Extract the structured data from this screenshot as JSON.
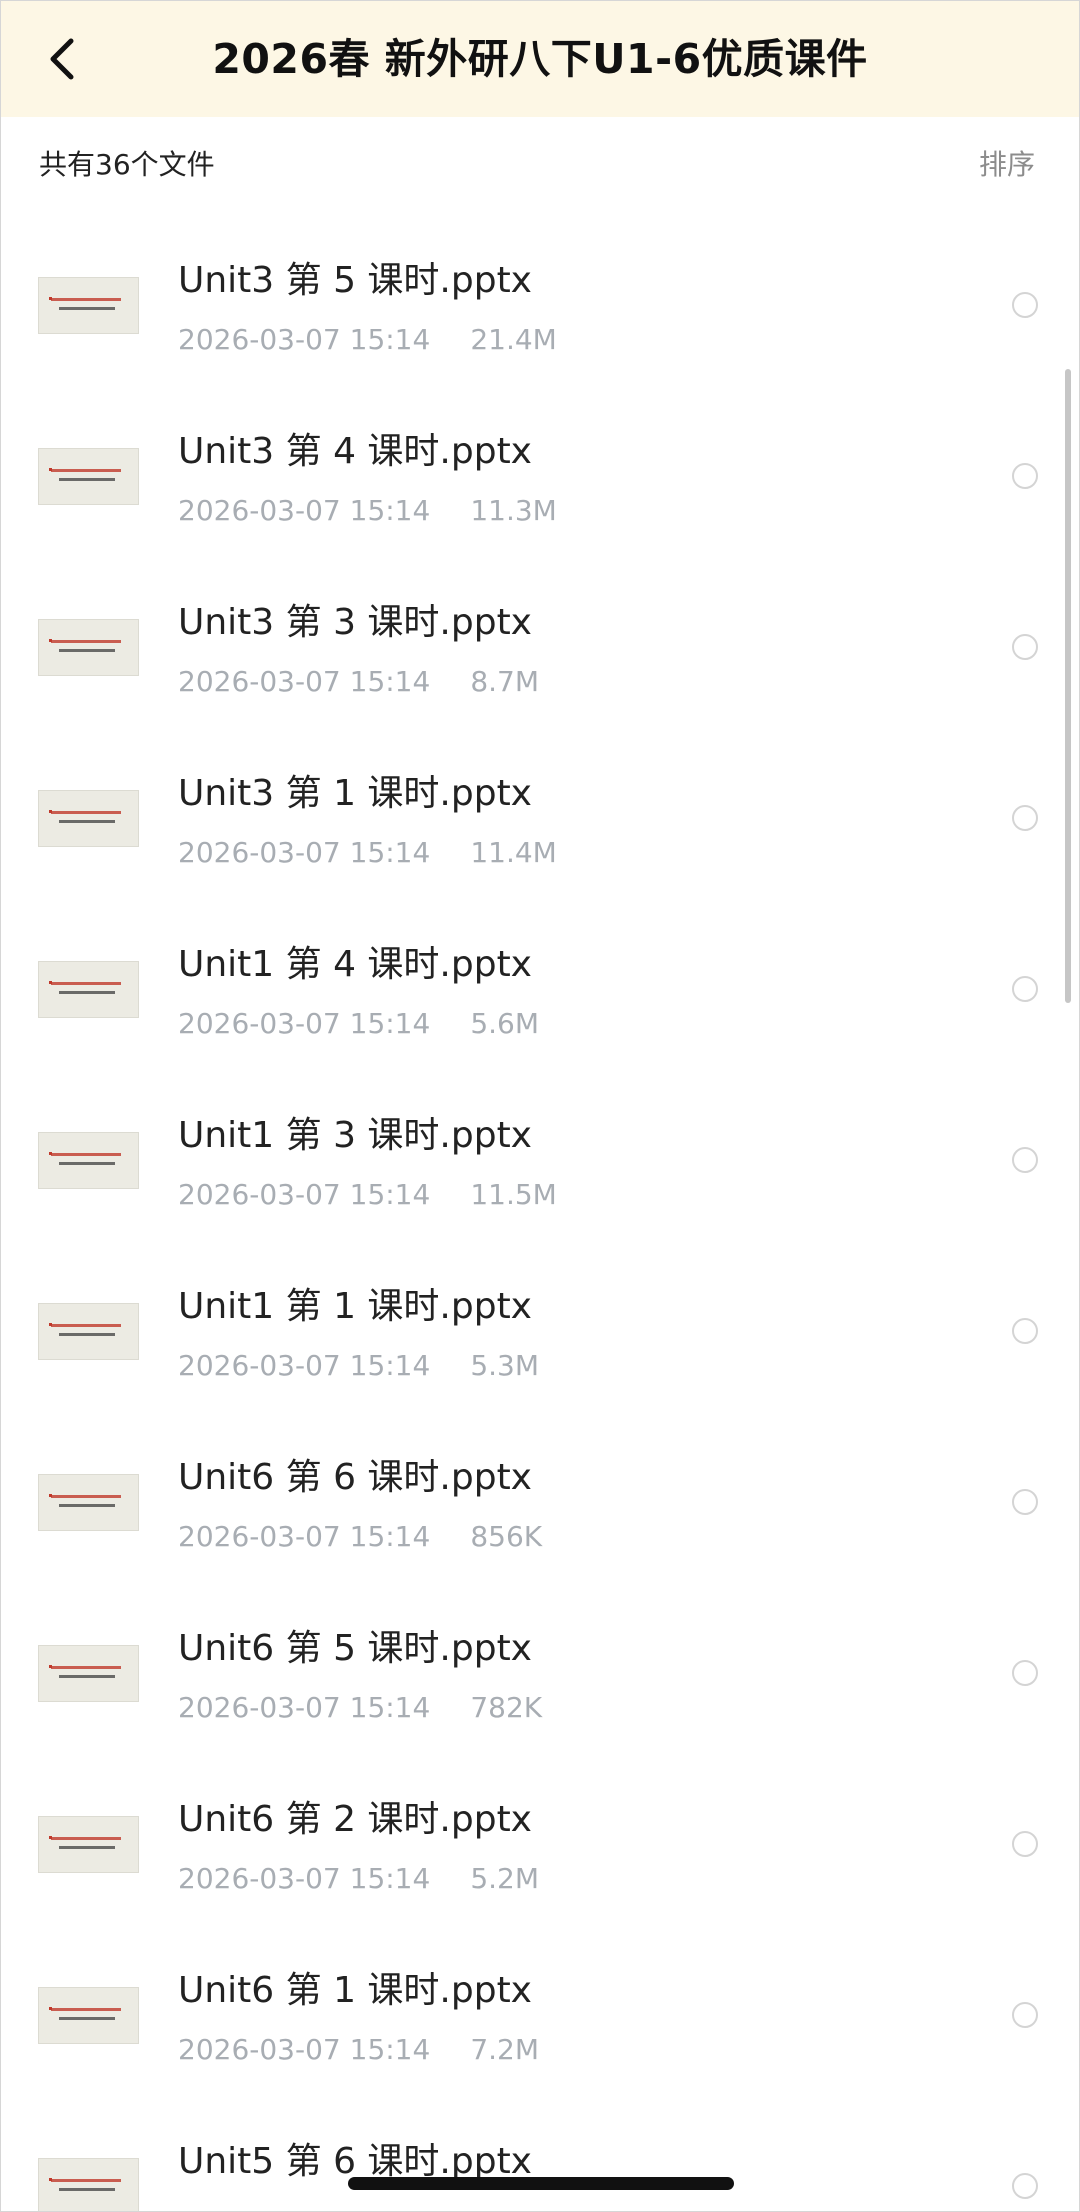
{
  "header": {
    "back_icon": "chevron-left-icon",
    "title": "2026春 新外研八下U1-6优质课件"
  },
  "toolbar": {
    "count_text": "共有36个文件",
    "sort_label": "排序"
  },
  "files": [
    {
      "name": "Unit3 第 5 课时.pptx",
      "date": "2026-03-07 15:14",
      "size": "21.4M"
    },
    {
      "name": "Unit3 第 4 课时.pptx",
      "date": "2026-03-07 15:14",
      "size": "11.3M"
    },
    {
      "name": "Unit3 第 3 课时.pptx",
      "date": "2026-03-07 15:14",
      "size": "8.7M"
    },
    {
      "name": "Unit3 第 1 课时.pptx",
      "date": "2026-03-07 15:14",
      "size": "11.4M"
    },
    {
      "name": "Unit1 第 4 课时.pptx",
      "date": "2026-03-07 15:14",
      "size": "5.6M"
    },
    {
      "name": "Unit1 第 3 课时.pptx",
      "date": "2026-03-07 15:14",
      "size": "11.5M"
    },
    {
      "name": "Unit1 第 1 课时.pptx",
      "date": "2026-03-07 15:14",
      "size": "5.3M"
    },
    {
      "name": "Unit6 第 6 课时.pptx",
      "date": "2026-03-07 15:14",
      "size": "856K"
    },
    {
      "name": "Unit6 第 5 课时.pptx",
      "date": "2026-03-07 15:14",
      "size": "782K"
    },
    {
      "name": "Unit6 第 2 课时.pptx",
      "date": "2026-03-07 15:14",
      "size": "5.2M"
    },
    {
      "name": "Unit6 第 1 课时.pptx",
      "date": "2026-03-07 15:14",
      "size": "7.2M"
    },
    {
      "name": "Unit5 第 6 课时.pptx",
      "date": "",
      "size": ""
    }
  ],
  "colors": {
    "header_bg": "#fdf7e5",
    "meta_text": "#a8adb3",
    "primary_text": "#222222"
  }
}
